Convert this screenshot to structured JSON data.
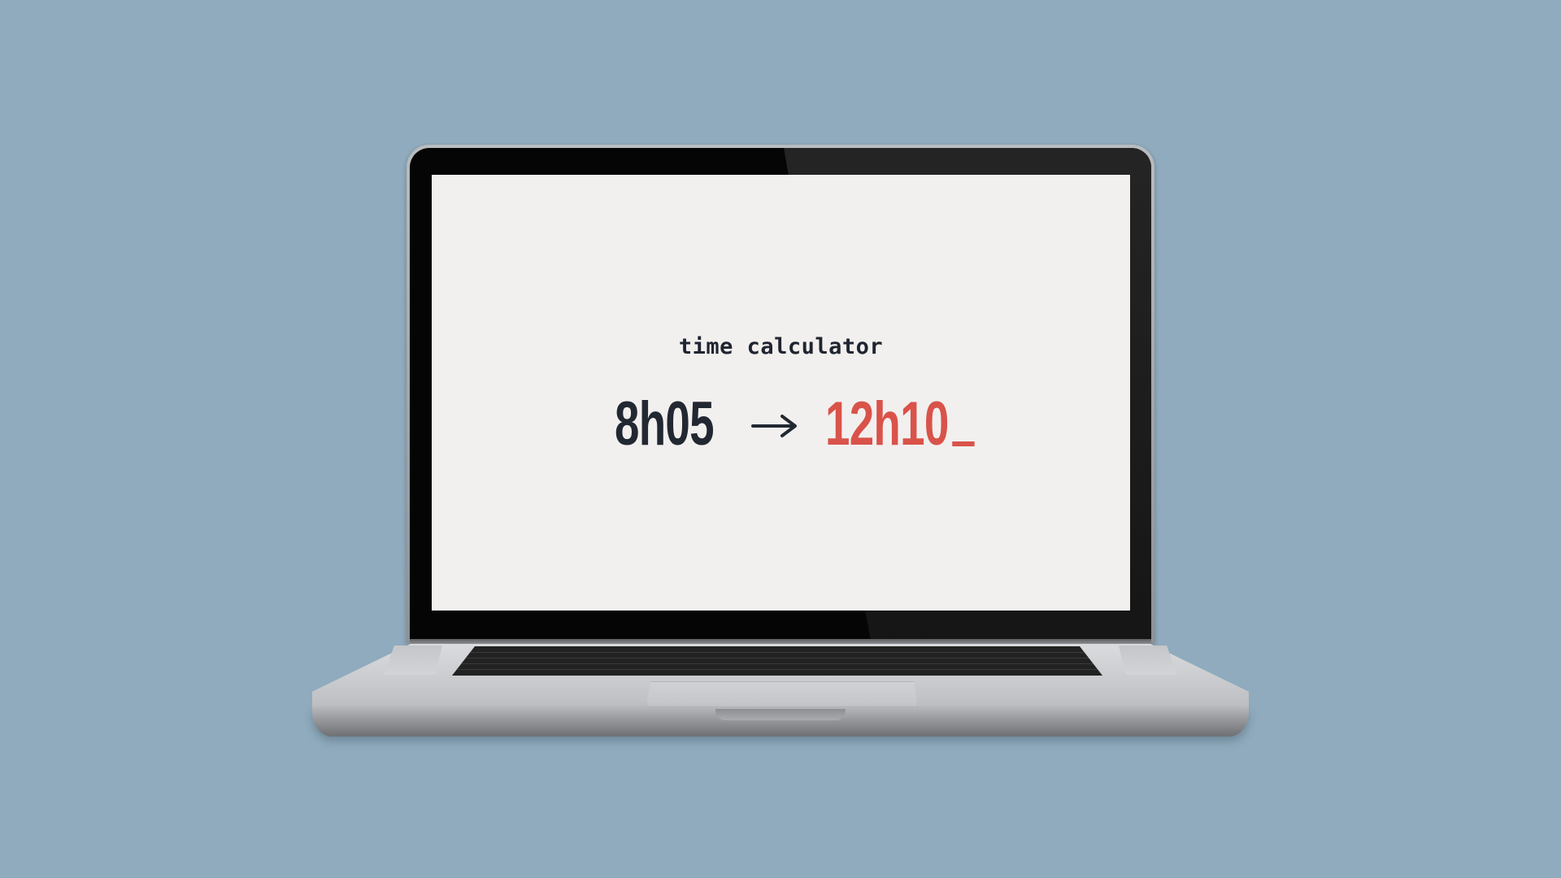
{
  "app": {
    "title": "time calculator"
  },
  "calculator": {
    "start_time": "8h05",
    "result_time": "12h10"
  },
  "icons": {
    "arrow": "arrow-right-icon",
    "cursor": "text-cursor-underscore"
  },
  "colors": {
    "background": "#8fabbd",
    "screen": "#f2f0ef",
    "text_dark": "#222831",
    "accent_red": "#d9534a"
  }
}
